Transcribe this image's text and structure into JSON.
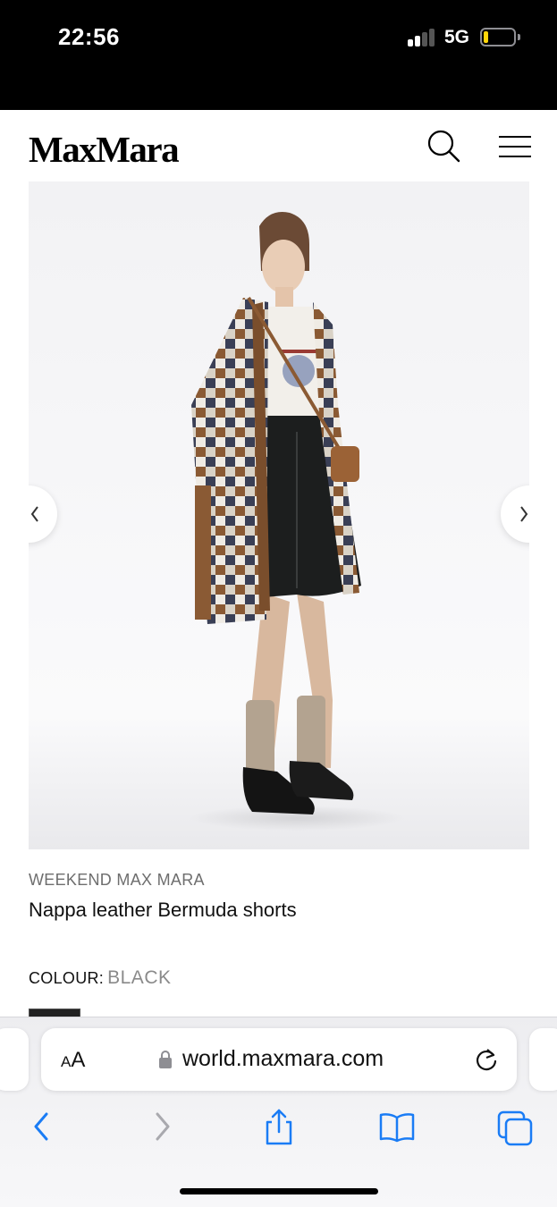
{
  "status_bar": {
    "time": "22:56",
    "network": "5G",
    "battery_level": 0.15
  },
  "site": {
    "logo": "MaxMara",
    "search_icon": "search-icon",
    "menu_icon": "hamburger-menu-icon"
  },
  "gallery": {
    "prev_icon": "chevron-left-icon",
    "next_icon": "chevron-right-icon"
  },
  "product": {
    "brand": "WEEKEND MAX MARA",
    "name": "Nappa leather Bermuda shorts",
    "colour_label": "COLOUR:",
    "colour_value": "BLACK",
    "swatch_color": "#222222"
  },
  "browser": {
    "aa_small": "A",
    "aa_large": "A",
    "url": "world.maxmara.com",
    "toolbar": {
      "back_icon": "chevron-left-icon",
      "forward_icon": "chevron-right-icon",
      "share_icon": "share-icon",
      "bookmarks_icon": "book-icon",
      "tabs_icon": "tabs-icon"
    },
    "accent_color": "#1a7cf5"
  }
}
